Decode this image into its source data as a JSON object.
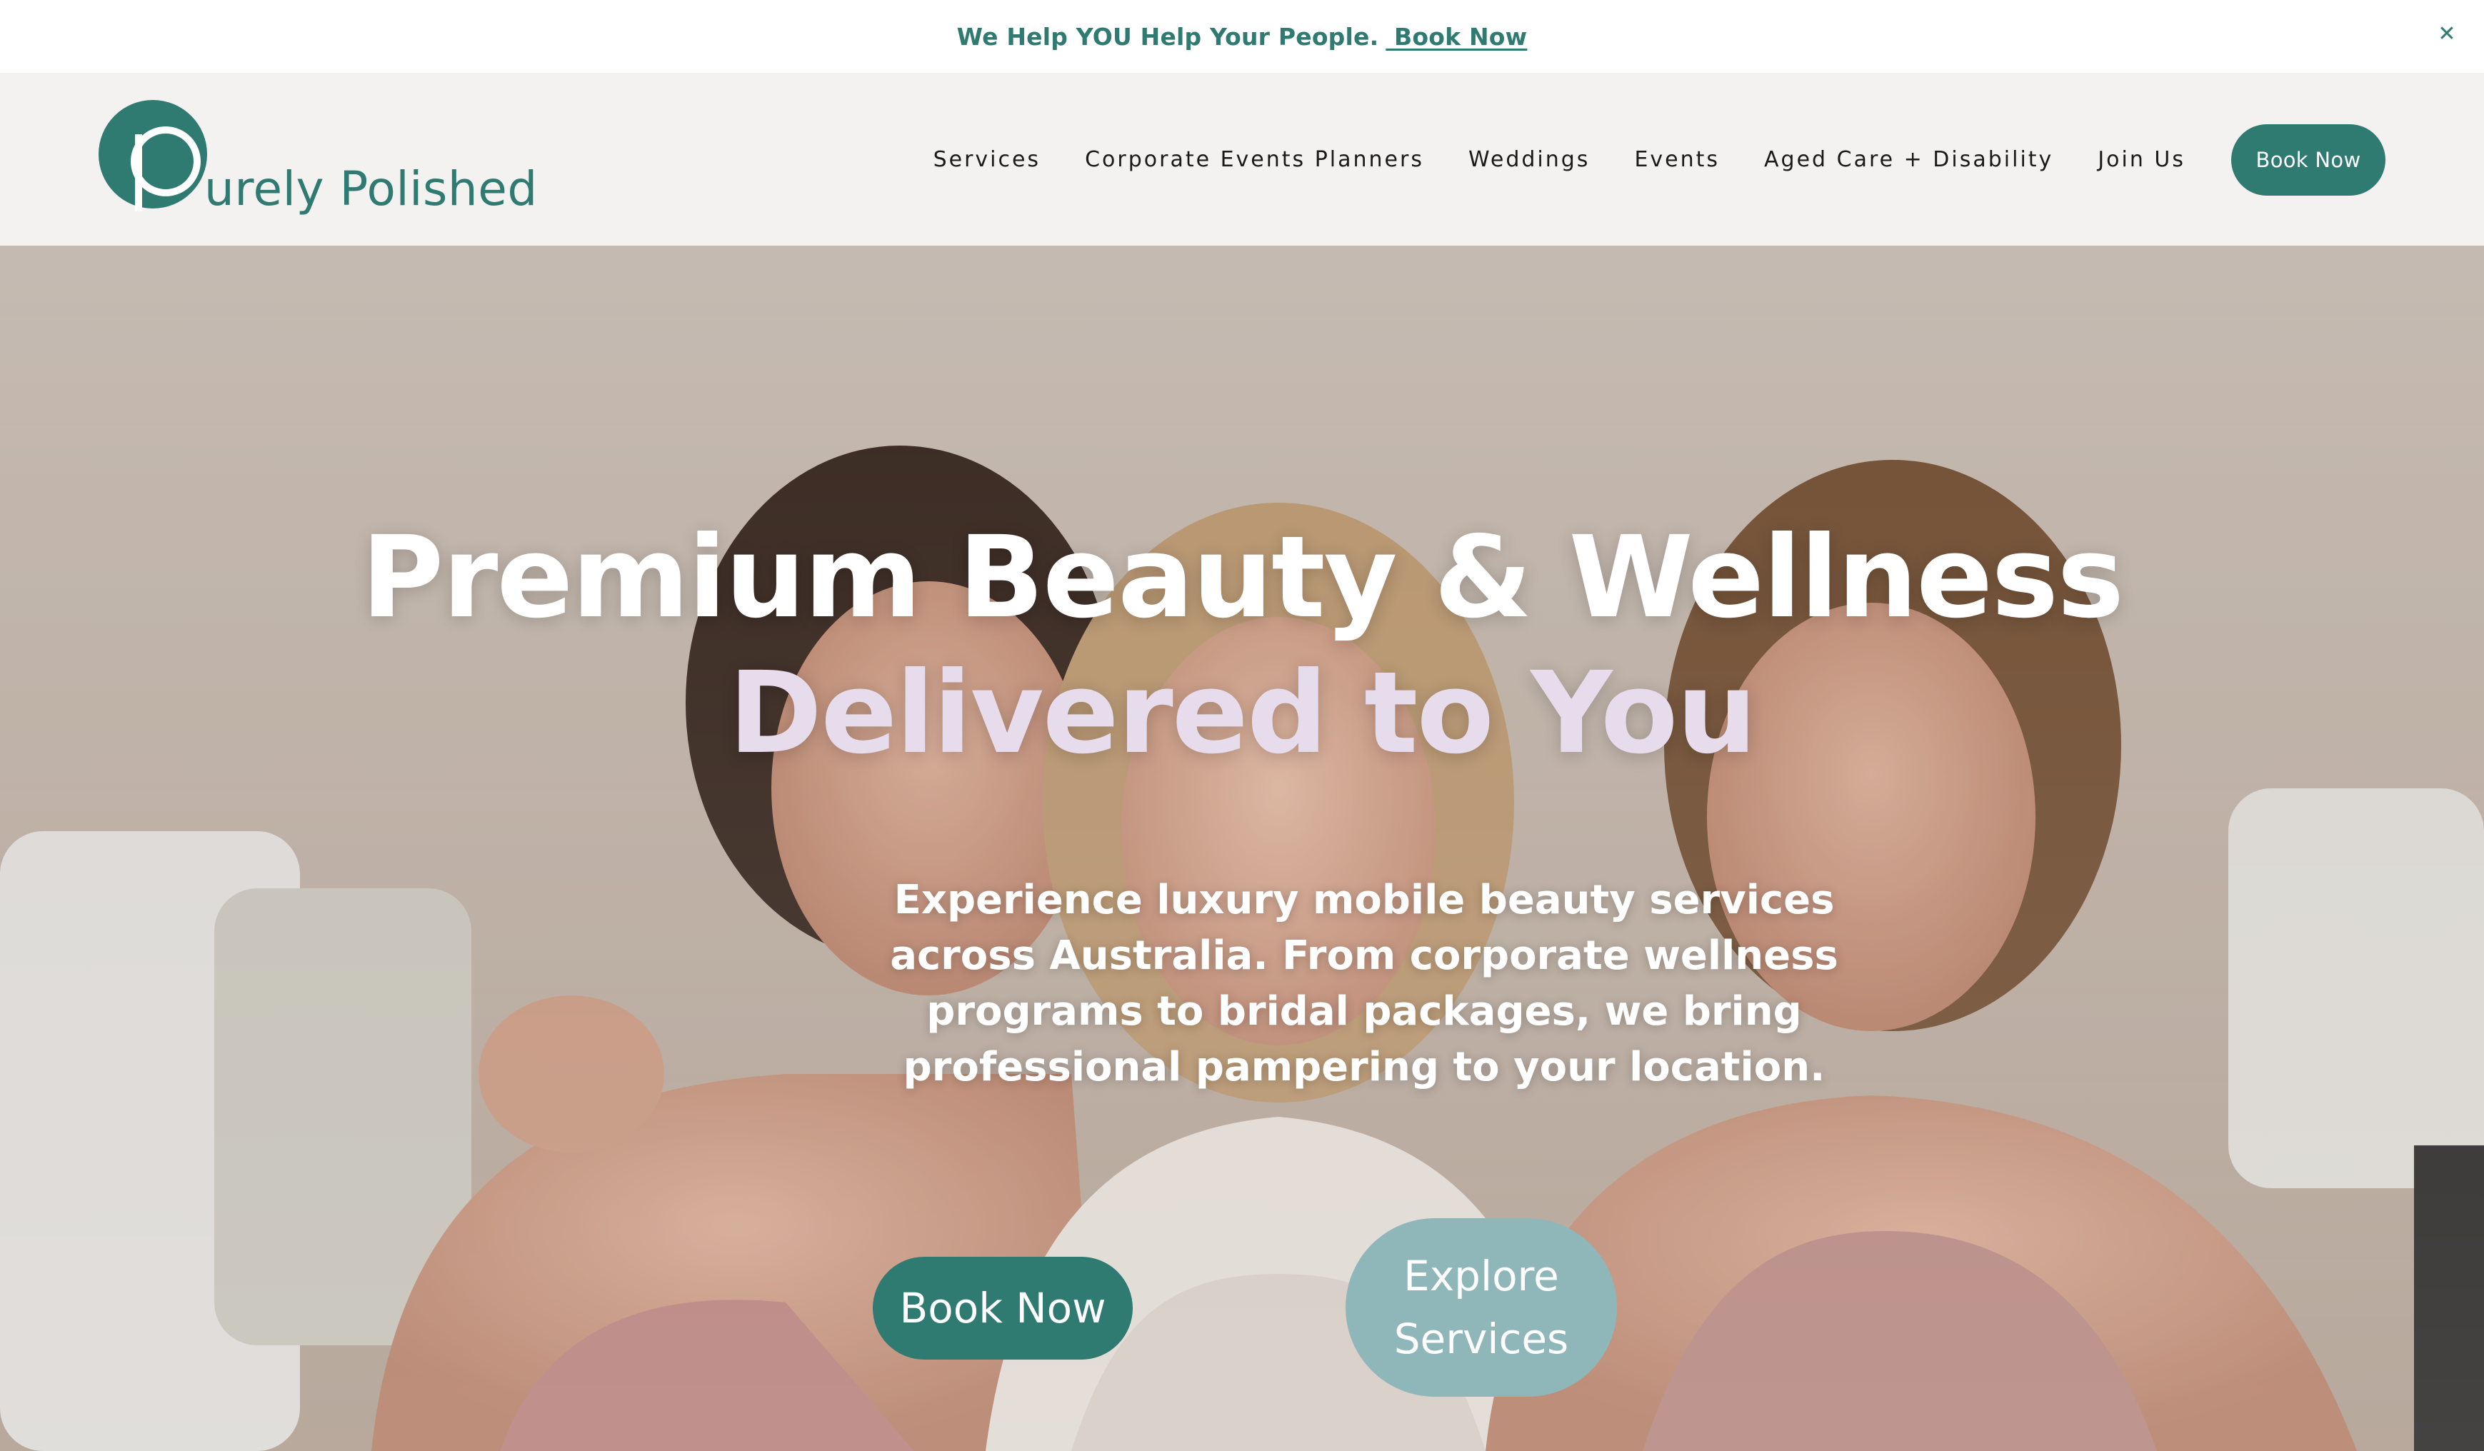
{
  "announcement": {
    "text": "We Help YOU Help Your People.",
    "link_label": " Book Now",
    "close_icon": "close-icon"
  },
  "header": {
    "logo_text": "urely Polished",
    "logo_icon": "purely-polished-logo-mark",
    "nav": [
      {
        "label": "Services"
      },
      {
        "label": "Corporate Events Planners"
      },
      {
        "label": "Weddings"
      },
      {
        "label": "Events"
      },
      {
        "label": "Aged Care + Disability"
      },
      {
        "label": "Join Us"
      }
    ],
    "cta_label": "Book Now"
  },
  "hero": {
    "title_line1": "Premium Beauty & Wellness",
    "title_line2": "Delivered to You",
    "subtitle": "Experience luxury mobile beauty services across Australia. From corporate wellness programs to bridal packages, we bring professional pampering to your location.",
    "primary_button": "Book Now",
    "secondary_button": "Explore Services"
  },
  "colors": {
    "brand_teal": "#2f7a71",
    "soft_teal": "#8fb7b9",
    "lavender": "#e7dcec",
    "header_bg": "#f3f2f1"
  }
}
